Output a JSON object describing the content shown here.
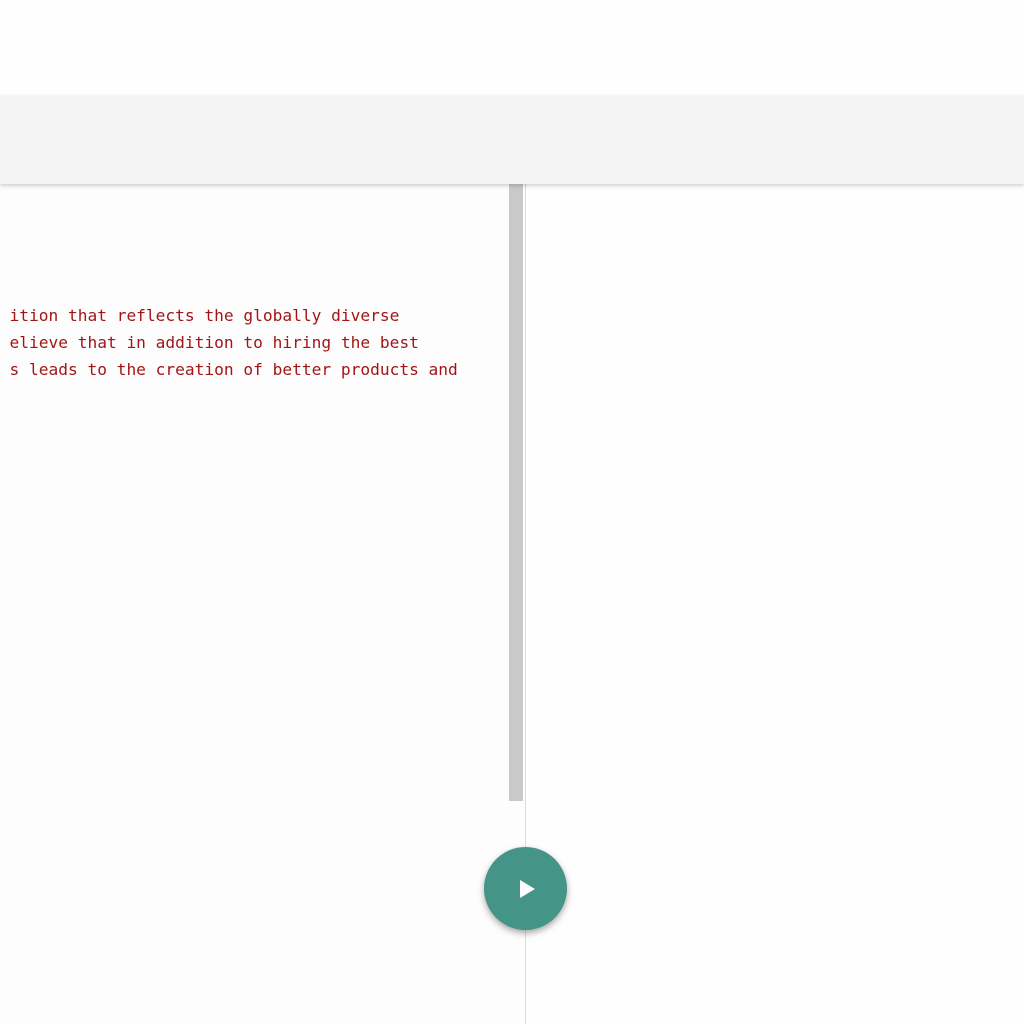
{
  "editor": {
    "lines": [
      "  ition that reflects the globally diverse",
      "  elieve that in addition to hiring the best",
      "  s leads to the creation of better products and"
    ]
  },
  "run_button": {
    "icon": "play-icon"
  },
  "colors": {
    "code_string": "#a31515",
    "run_button": "#449488",
    "toolbar": "#f4f4f5",
    "scrollbar_thumb": "#c9c9c9"
  }
}
